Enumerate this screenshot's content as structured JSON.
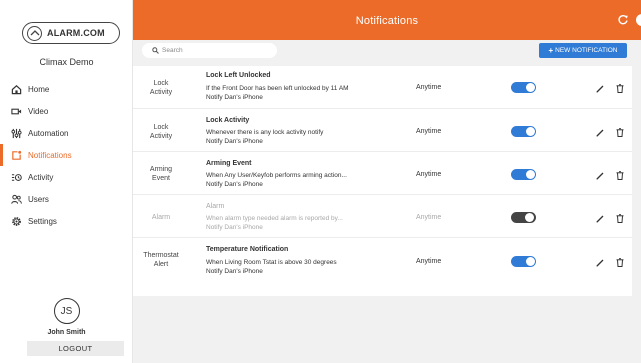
{
  "brand": {
    "name": "ALARM.COM",
    "accent": "#ec6b29",
    "primary_blue": "#2f7bd6"
  },
  "site": {
    "name": "Climax Demo"
  },
  "nav": [
    {
      "label": "Home",
      "icon": "home-icon",
      "active": false
    },
    {
      "label": "Video",
      "icon": "video-camera-icon",
      "active": false
    },
    {
      "label": "Automation",
      "icon": "automation-sliders-icon",
      "active": false
    },
    {
      "label": "Notifications",
      "icon": "notification-icon",
      "active": true
    },
    {
      "label": "Activity",
      "icon": "activity-list-icon",
      "active": false
    },
    {
      "label": "Users",
      "icon": "users-icon",
      "active": false
    },
    {
      "label": "Settings",
      "icon": "gear-icon",
      "active": false
    }
  ],
  "user": {
    "initials": "JS",
    "name": "John Smith",
    "logout_label": "LOGOUT"
  },
  "header": {
    "title": "Notifications",
    "refresh_icon": "refresh-icon"
  },
  "toolbar": {
    "search_placeholder": "Search",
    "new_label": "NEW NOTIFICATION"
  },
  "notifications": [
    {
      "type_line1": "Lock",
      "type_line2": "Activity",
      "title": "Lock Left Unlocked",
      "description": "If the Front Door has been left unlocked by 11 AM",
      "target": "Notify Dan's iPhone",
      "schedule": "Anytime",
      "enabled": true
    },
    {
      "type_line1": "Lock",
      "type_line2": "Activity",
      "title": "Lock Activity",
      "description": "Whenever there is any lock activity notify",
      "target": "Notify Dan's iPhone",
      "schedule": "Anytime",
      "enabled": true
    },
    {
      "type_line1": "Arming",
      "type_line2": "Event",
      "title": "Arming Event",
      "description": "When Any User/Keyfob performs arming action...",
      "target": "Notify Dan's iPhone",
      "schedule": "Anytime",
      "enabled": true
    },
    {
      "type_line1": "Alarm",
      "type_line2": "",
      "title": "Alarm",
      "description": "When alarm type needed alarm is reported by...",
      "target": "Notify Dan's iPhone",
      "schedule": "Anytime",
      "enabled": false
    },
    {
      "type_line1": "Thermostat",
      "type_line2": "Alert",
      "title": "Temperature Notification",
      "description": "When Living Room Tstat is above 30 degrees",
      "target": "Notify Dan's iPhone",
      "schedule": "Anytime",
      "enabled": true
    }
  ]
}
